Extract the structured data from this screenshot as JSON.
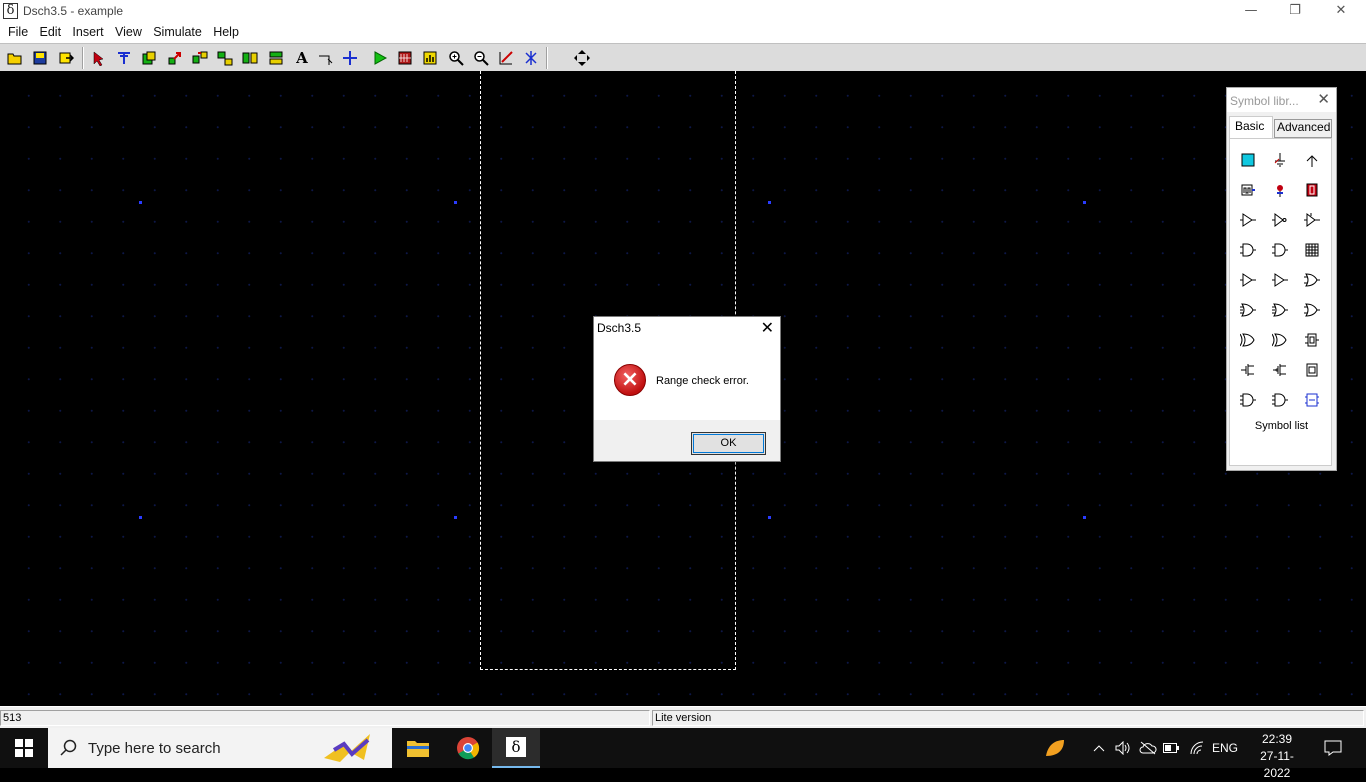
{
  "window": {
    "title": "Dsch3.5 - example",
    "app_icon": "δ",
    "minimize": "—",
    "restore": "❐",
    "close": "✕"
  },
  "menu": [
    "File",
    "Edit",
    "Insert",
    "View",
    "Simulate",
    "Help"
  ],
  "toolbar": {
    "tools": [
      "open-folder-icon",
      "save-icon",
      "export-icon",
      "select-arrow-icon",
      "wire-icon",
      "group-icon",
      "ungroup-icon",
      "rotate-icon",
      "flip-icon",
      "duplicate-icon",
      "align-icon",
      "text-tool-icon",
      "connect-icon",
      "node-icon",
      "run-simulation-icon",
      "timing-icon",
      "chart-icon",
      "zoom-in-icon",
      "zoom-out-icon",
      "measure-icon",
      "extract-icon"
    ],
    "text_tool_glyph": "A"
  },
  "status": {
    "left": "513",
    "right": "Lite version"
  },
  "dialog": {
    "title": "Dsch3.5",
    "close": "✕",
    "icon": "×",
    "message": "Range check error.",
    "ok_label": "OK"
  },
  "symbol_library": {
    "title": "Symbol libr...",
    "close": "✕",
    "tabs": [
      "Basic",
      "Advanced"
    ],
    "symbols": [
      "button-icon",
      "ground-icon",
      "vdd-icon",
      "clock-icon",
      "led-icon",
      "display-icon",
      "buffer-icon",
      "inverter-icon",
      "nmos-icon",
      "and-gate-icon",
      "nand-gate-icon",
      "keyboard-icon",
      "tristate-icon",
      "tristate-inv-icon",
      "or-gate-icon",
      "nor-gate-icon",
      "nor3-icon",
      "xor-gate-icon",
      "xnor-gate-icon",
      "xor3-icon",
      "dff-icon",
      "pmos-icon",
      "nmos2-icon",
      "latch-icon",
      "mux-icon",
      "demux-icon",
      "counter-icon"
    ],
    "list_label": "Symbol list"
  },
  "taskbar": {
    "search_placeholder": "Type here to search",
    "lang": "ENG",
    "time": "22:39",
    "date": "27-11-2022"
  }
}
